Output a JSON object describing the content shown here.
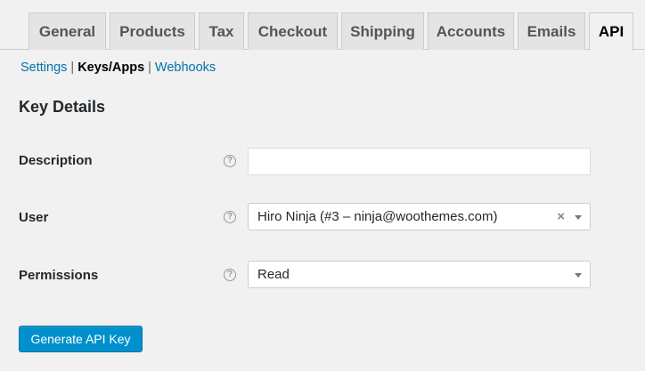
{
  "tabs": [
    {
      "label": "General"
    },
    {
      "label": "Products"
    },
    {
      "label": "Tax"
    },
    {
      "label": "Checkout"
    },
    {
      "label": "Shipping"
    },
    {
      "label": "Accounts"
    },
    {
      "label": "Emails"
    },
    {
      "label": "API",
      "active": true
    }
  ],
  "subnav": {
    "settings": "Settings",
    "sep1": "|",
    "keys_apps": "Keys/Apps",
    "sep2": "|",
    "webhooks": "Webhooks"
  },
  "heading": "Key Details",
  "form": {
    "description": {
      "label": "Description",
      "value": "",
      "help": "?"
    },
    "user": {
      "label": "User",
      "value": "Hiro Ninja (#3 – ninja@woothemes.com)",
      "clear": "×",
      "help": "?"
    },
    "permissions": {
      "label": "Permissions",
      "value": "Read",
      "help": "?"
    }
  },
  "generate_button": "Generate API Key",
  "colors": {
    "accent": "#0091cd",
    "link": "#0073aa",
    "background": "#f1f1f1"
  }
}
